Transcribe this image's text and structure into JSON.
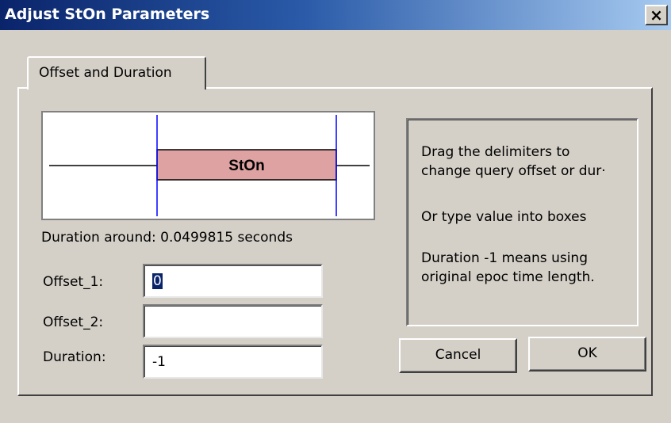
{
  "window": {
    "title": "Adjust StOn Parameters",
    "close_glyph": "×"
  },
  "tabs": [
    {
      "label": "Offset and Duration",
      "selected": true
    }
  ],
  "timeline": {
    "bar_label": "StOn",
    "bar_color": "#dea2a2"
  },
  "duration_text": "Duration around: 0.0499815 seconds",
  "fields": {
    "offset_1": {
      "label": "Offset_1:",
      "value": "0"
    },
    "offset_2": {
      "label": "Offset_2:",
      "value": ""
    },
    "duration": {
      "label": "Duration:",
      "value": "-1"
    }
  },
  "info": {
    "line1": "Drag the delimiters to",
    "line2": "change query offset or dur·",
    "line3": "Or type value into boxes",
    "line4": "Duration -1 means using",
    "line5": "original epoc time length."
  },
  "buttons": {
    "cancel": "Cancel",
    "ok": "OK"
  },
  "colors": {
    "titlebar_start": "#0a246a",
    "titlebar_end": "#a6caf0",
    "dialog_bg": "#d4d0c8",
    "delimiter_line": "#0000ff"
  }
}
